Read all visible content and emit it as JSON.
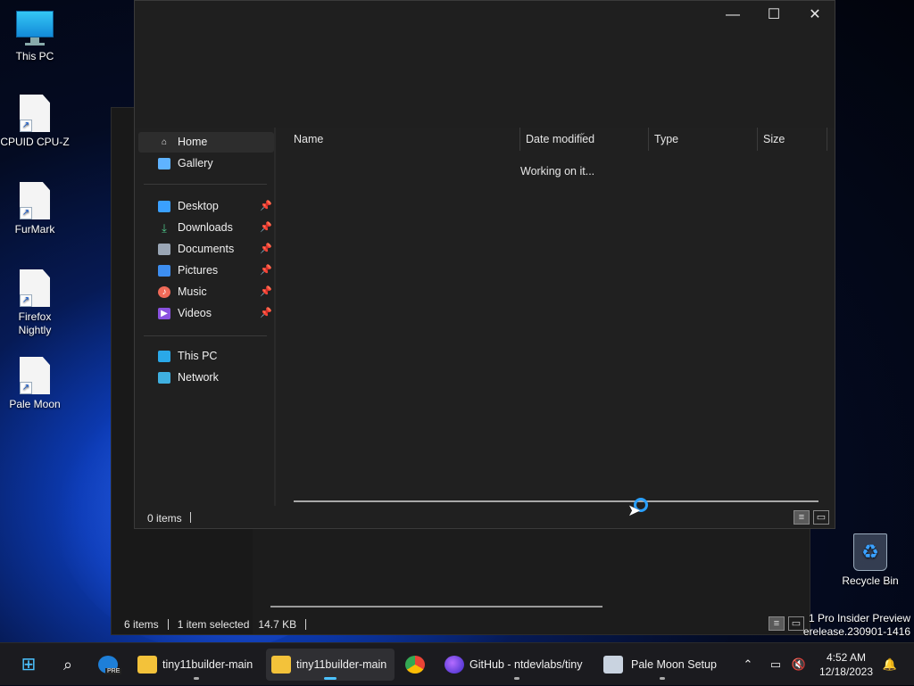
{
  "desktop": {
    "icons": [
      {
        "label": "This PC"
      },
      {
        "label": "CPUID CPU-Z"
      },
      {
        "label": "FurMark"
      },
      {
        "label": "Firefox Nightly"
      },
      {
        "label": "Pale Moon"
      },
      {
        "label": "Recycle Bin"
      }
    ],
    "watermark_line1": "1 Pro Insider Preview",
    "watermark_line2": "erelease.230901-1416"
  },
  "back_window": {
    "status_items": "6 items",
    "status_selected": "1 item selected",
    "status_size": "14.7 KB"
  },
  "front_window": {
    "controls": {
      "minimize": "—",
      "maximize": "☐",
      "close": "✕"
    },
    "nav": [
      {
        "label": "Home",
        "icon": "home-icon",
        "color": "#e8e8e8"
      },
      {
        "label": "Gallery",
        "icon": "gallery-icon",
        "color": "#5fb3ff"
      },
      {
        "label": "Desktop",
        "icon": "desktop-icon",
        "color": "#3aa0ff",
        "pinned": true
      },
      {
        "label": "Downloads",
        "icon": "download-icon",
        "color": "#4ec98b",
        "pinned": true
      },
      {
        "label": "Documents",
        "icon": "document-icon",
        "color": "#9aa6b5",
        "pinned": true
      },
      {
        "label": "Pictures",
        "icon": "picture-icon",
        "color": "#3d8ef0",
        "pinned": true
      },
      {
        "label": "Music",
        "icon": "music-icon",
        "color": "#f06a58",
        "pinned": true
      },
      {
        "label": "Videos",
        "icon": "video-icon",
        "color": "#8a52e0",
        "pinned": true
      },
      {
        "label": "This PC",
        "icon": "computer-icon",
        "color": "#2aa8e8"
      },
      {
        "label": "Network",
        "icon": "network-icon",
        "color": "#3fb0e0"
      }
    ],
    "columns": [
      "Name",
      "Date modified",
      "Type",
      "Size"
    ],
    "working_text": "Working on it...",
    "status_items": "0 items"
  },
  "taskbar": {
    "apps": [
      {
        "label": "tiny11builder-main",
        "icon": "folder-icon"
      },
      {
        "label": "tiny11builder-main",
        "icon": "folder-icon"
      },
      {
        "label": "GitHub - ntdevlabs/tiny",
        "icon": "firefox-icon"
      },
      {
        "label": "Pale Moon Setup",
        "icon": "installer-icon"
      }
    ],
    "edge_badge": "PRE",
    "time": "4:52 AM",
    "date": "12/18/2023"
  }
}
